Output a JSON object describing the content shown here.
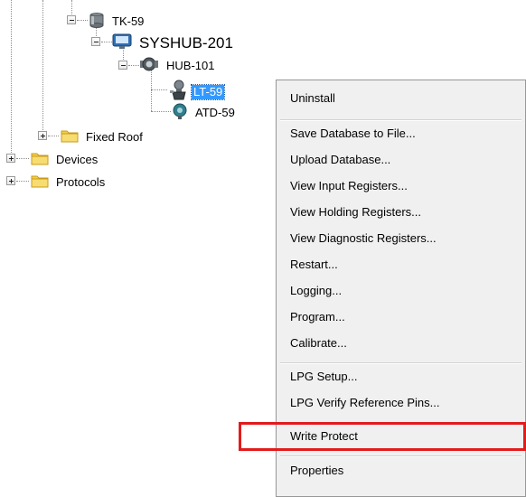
{
  "tree": {
    "nodes": [
      {
        "id": "tk59",
        "label": "TK-59",
        "icon": "tank-icon",
        "expander": "minus"
      },
      {
        "id": "syshub",
        "label": "SYSHUB-201",
        "icon": "monitor-icon",
        "expander": "minus"
      },
      {
        "id": "hub101",
        "label": "HUB-101",
        "icon": "hub-device-icon",
        "expander": "minus"
      },
      {
        "id": "lt59",
        "label": "LT-59",
        "icon": "level-transmitter-icon",
        "selected": true
      },
      {
        "id": "atd59",
        "label": "ATD-59",
        "icon": "temperature-sensor-icon"
      },
      {
        "id": "fixedroof",
        "label": "Fixed Roof",
        "icon": "folder-icon",
        "expander": "plus"
      },
      {
        "id": "devices",
        "label": "Devices",
        "icon": "folder-icon",
        "expander": "plus"
      },
      {
        "id": "protocols",
        "label": "Protocols",
        "icon": "folder-icon",
        "expander": "plus"
      }
    ]
  },
  "context_menu": {
    "items": [
      {
        "label": "Uninstall"
      },
      {
        "label": "Save Database to File..."
      },
      {
        "label": "Upload Database..."
      },
      {
        "label": "View Input Registers..."
      },
      {
        "label": "View Holding Registers..."
      },
      {
        "label": "View Diagnostic Registers..."
      },
      {
        "label": "Restart..."
      },
      {
        "label": "Logging..."
      },
      {
        "label": "Program..."
      },
      {
        "label": "Calibrate..."
      },
      {
        "label": "LPG Setup..."
      },
      {
        "label": "LPG Verify Reference Pins..."
      },
      {
        "label": "Write Protect",
        "highlighted": true
      },
      {
        "label": "Properties"
      }
    ]
  },
  "colors": {
    "selection": "#3399ff",
    "highlight_box": "#e21b1b",
    "menu_background": "#f0f0f0",
    "folder": "#f2cf4a"
  }
}
